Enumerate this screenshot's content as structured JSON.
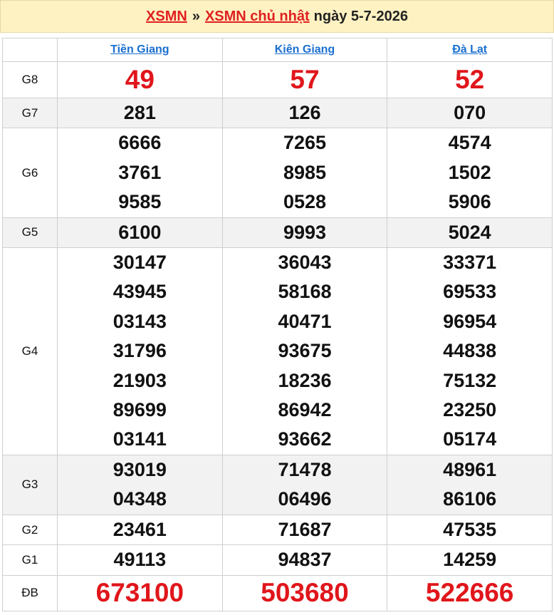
{
  "header": {
    "link1": "XSMN",
    "separator": "»",
    "link2": "XSMN chủ nhật",
    "date_text": "ngày 5-7-2026"
  },
  "provinces": [
    "Tiền Giang",
    "Kiên Giang",
    "Đà Lạt"
  ],
  "prizes": {
    "g8": {
      "label": "G8",
      "values": [
        [
          "49"
        ],
        [
          "57"
        ],
        [
          "52"
        ]
      ]
    },
    "g7": {
      "label": "G7",
      "values": [
        [
          "281"
        ],
        [
          "126"
        ],
        [
          "070"
        ]
      ]
    },
    "g6": {
      "label": "G6",
      "values": [
        [
          "6666",
          "3761",
          "9585"
        ],
        [
          "7265",
          "8985",
          "0528"
        ],
        [
          "4574",
          "1502",
          "5906"
        ]
      ]
    },
    "g5": {
      "label": "G5",
      "values": [
        [
          "6100"
        ],
        [
          "9993"
        ],
        [
          "5024"
        ]
      ]
    },
    "g4": {
      "label": "G4",
      "values": [
        [
          "30147",
          "43945",
          "03143",
          "31796",
          "21903",
          "89699",
          "03141"
        ],
        [
          "36043",
          "58168",
          "40471",
          "93675",
          "18236",
          "86942",
          "93662"
        ],
        [
          "33371",
          "69533",
          "96954",
          "44838",
          "75132",
          "23250",
          "05174"
        ]
      ]
    },
    "g3": {
      "label": "G3",
      "values": [
        [
          "93019",
          "04348"
        ],
        [
          "71478",
          "06496"
        ],
        [
          "48961",
          "86106"
        ]
      ]
    },
    "g2": {
      "label": "G2",
      "values": [
        [
          "23461"
        ],
        [
          "71687"
        ],
        [
          "47535"
        ]
      ]
    },
    "g1": {
      "label": "G1",
      "values": [
        [
          "49113"
        ],
        [
          "94837"
        ],
        [
          "14259"
        ]
      ]
    },
    "db": {
      "label": "ĐB",
      "values": [
        [
          "673100"
        ],
        [
          "503680"
        ],
        [
          "522666"
        ]
      ]
    }
  }
}
